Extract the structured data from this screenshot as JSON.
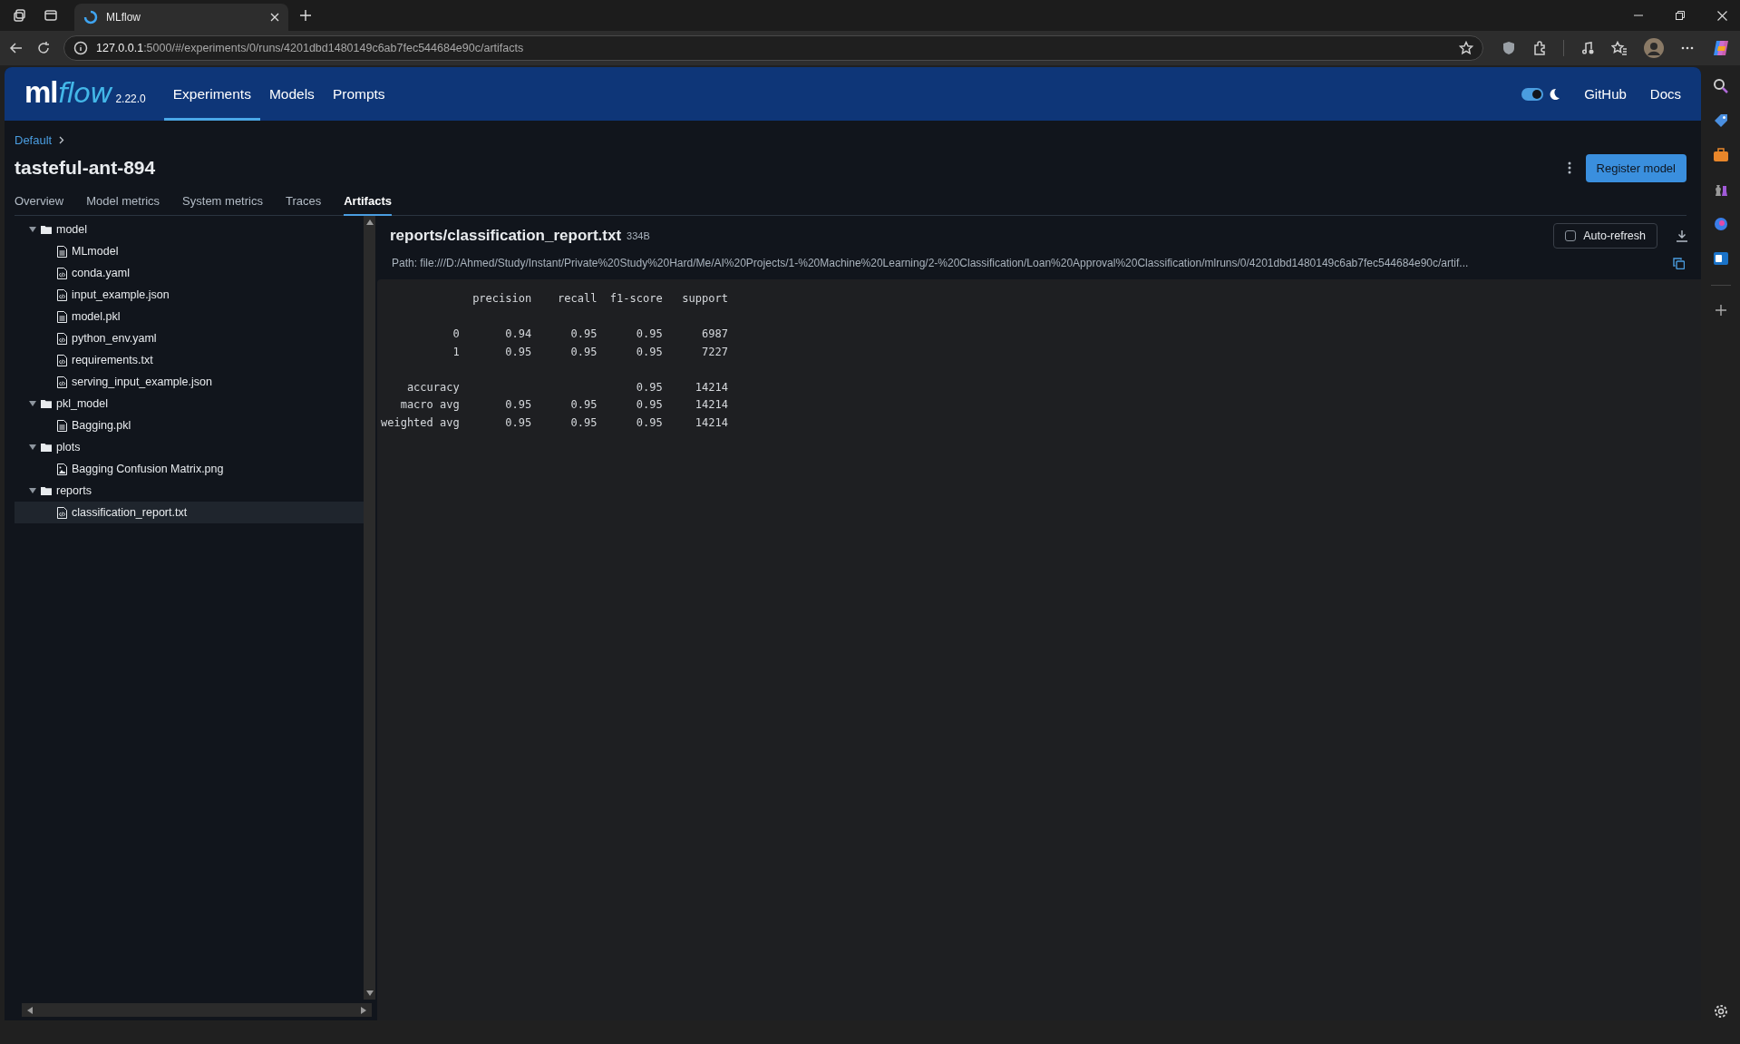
{
  "browser": {
    "tab_title": "MLflow",
    "url_host": "127.0.0.1",
    "url_rest": ":5000/#/experiments/0/runs/4201dbd1480149c6ab7fec544684e90c/artifacts"
  },
  "header": {
    "logo_ml": "ml",
    "logo_flow": "flow",
    "version": "2.22.0",
    "nav": [
      {
        "label": "Experiments",
        "selected": true
      },
      {
        "label": "Models",
        "selected": false
      },
      {
        "label": "Prompts",
        "selected": false
      }
    ],
    "dark_mode": {
      "on": true
    },
    "links": [
      "GitHub",
      "Docs"
    ]
  },
  "breadcrumb": [
    "Default"
  ],
  "run_title": "tasteful-ant-894",
  "register_button": "Register model",
  "tabs": [
    {
      "label": "Overview",
      "selected": false
    },
    {
      "label": "Model metrics",
      "selected": false
    },
    {
      "label": "System metrics",
      "selected": false
    },
    {
      "label": "Traces",
      "selected": false
    },
    {
      "label": "Artifacts",
      "selected": true
    }
  ],
  "tree": [
    {
      "name": "model",
      "kind": "folder",
      "expanded": true,
      "selected": false,
      "children": [
        {
          "name": "MLmodel",
          "kind": "document",
          "selected": false
        },
        {
          "name": "conda.yaml",
          "kind": "code",
          "selected": false
        },
        {
          "name": "input_example.json",
          "kind": "code",
          "selected": false
        },
        {
          "name": "model.pkl",
          "kind": "document",
          "selected": false
        },
        {
          "name": "python_env.yaml",
          "kind": "code",
          "selected": false
        },
        {
          "name": "requirements.txt",
          "kind": "code",
          "selected": false
        },
        {
          "name": "serving_input_example.json",
          "kind": "code",
          "selected": false
        }
      ]
    },
    {
      "name": "pkl_model",
      "kind": "folder",
      "expanded": true,
      "selected": false,
      "children": [
        {
          "name": "Bagging.pkl",
          "kind": "document",
          "selected": false
        }
      ]
    },
    {
      "name": "plots",
      "kind": "folder",
      "expanded": true,
      "selected": false,
      "children": [
        {
          "name": "Bagging Confusion Matrix.png",
          "kind": "image",
          "selected": false
        }
      ]
    },
    {
      "name": "reports",
      "kind": "folder",
      "expanded": true,
      "selected": false,
      "children": [
        {
          "name": "classification_report.txt",
          "kind": "code",
          "selected": true
        }
      ]
    }
  ],
  "viewer": {
    "file_path": "reports/classification_report.txt",
    "size": "334B",
    "auto_refresh": {
      "label": "Auto-refresh",
      "checked": false
    },
    "path": "Path: file:///D:/Ahmed/Study/Instant/Private%20Study%20Hard/Me/AI%20Projects/1-%20Machine%20Learning/2-%20Classification/Loan%20Approval%20Classification/mlruns/0/4201dbd1480149c6ab7fec544684e90c/artif...",
    "report_blocks": [
      [
        "              precision    recall  f1-score   support"
      ],
      [
        "           0       0.94      0.95      0.95      6987",
        "           1       0.95      0.95      0.95      7227"
      ],
      [
        "    accuracy                           0.95     14214",
        "   macro avg       0.95      0.95      0.95     14214",
        "weighted avg       0.95      0.95      0.95     14214"
      ]
    ]
  }
}
